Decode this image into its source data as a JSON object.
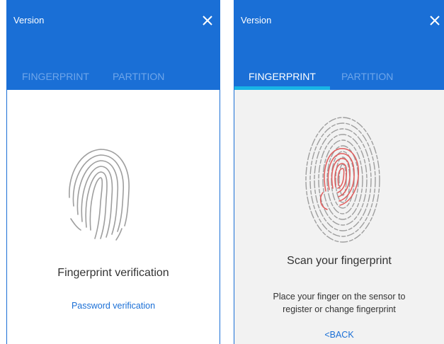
{
  "panels": [
    {
      "window_title": "Version",
      "tabs": [
        {
          "label": "FINGERPRINT",
          "active": false
        },
        {
          "label": "PARTITION",
          "active": false
        }
      ],
      "headline": "Fingerprint verification",
      "link": "Password verification",
      "icons": [
        "close-icon",
        "fingerprint-icon"
      ]
    },
    {
      "window_title": "Version",
      "tabs": [
        {
          "label": "FINGERPRINT",
          "active": true
        },
        {
          "label": "PARTITION",
          "active": false
        }
      ],
      "headline": "Scan your fingerprint",
      "instruction_line1": "Place your finger on the sensor to",
      "instruction_line2": "register or change fingerprint",
      "back_link": "<BACK",
      "icons": [
        "close-icon",
        "fingerprint-scan-icon"
      ]
    }
  ],
  "colors": {
    "header": "#1a6fd6",
    "tab_inactive": "#6fa6ea",
    "tab_underline": "#18b4e6",
    "fingerprint_lines": "#9e9e9e",
    "scan_highlight": "#e15b5b",
    "link": "#1a6fd6"
  }
}
